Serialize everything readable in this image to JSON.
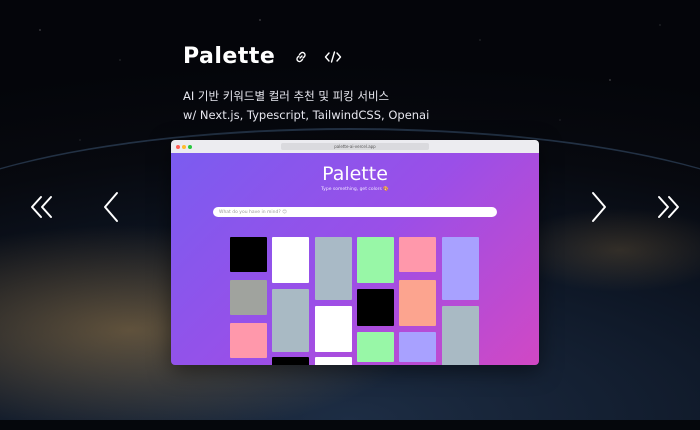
{
  "project": {
    "title": "Palette",
    "link_icon": "link-icon",
    "code_icon": "code-icon",
    "description": "AI 기반 키워드별 컬러 추천 및 피킹 서비스",
    "stack": "w/ Next.js, Typescript, TailwindCSS, Openai"
  },
  "nav": {
    "first_icon": "double-chevron-left-icon",
    "prev_icon": "chevron-left-icon",
    "next_icon": "chevron-right-icon",
    "last_icon": "double-chevron-right-icon"
  },
  "preview": {
    "url": "palette-ai-vercel.app",
    "app_title": "Palette",
    "app_subtitle": "Type something, get colors 🎨",
    "input_placeholder": "What do you have in mind? 😊",
    "swatch_colors": [
      [
        "#000000",
        "#a0a39e",
        "#ff98ab"
      ],
      [
        "#ffffff",
        "#a9bac4",
        "#000000"
      ],
      [
        "#a9bac6",
        "#ffffff",
        "#ffffff"
      ],
      [
        "#98f7a7",
        "#000000",
        "#98f7a7"
      ],
      [
        "#ff98ab",
        "#fca48f",
        "#a8a1ff"
      ],
      [
        "#a8a1ff",
        "#a9bac4"
      ]
    ]
  }
}
